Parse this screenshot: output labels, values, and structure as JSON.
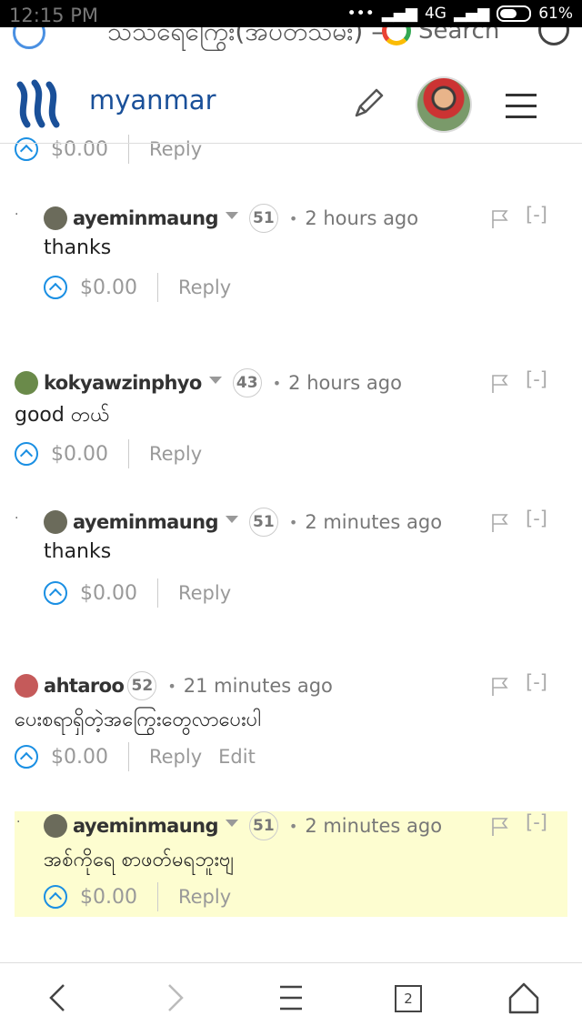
{
  "status_bar": {
    "time": "12:15 PM",
    "network": "4G",
    "battery": "61%"
  },
  "browser": {
    "address": "သသရေကြွေး(အပတသမး) –",
    "search_label": "Search"
  },
  "header": {
    "brand": "myanmar"
  },
  "top_partial": {
    "payout": "$0.00",
    "reply": "Reply"
  },
  "comments": [
    {
      "user": "ayeminmaung",
      "rep": "51",
      "time": "2 hours ago",
      "body": "thanks",
      "payout": "$0.00",
      "reply": "Reply",
      "toggle": "[-]",
      "nested": true
    },
    {
      "user": "kokyawzinphyo",
      "rep": "43",
      "time": "2 hours ago",
      "body": "good တယ်",
      "payout": "$0.00",
      "reply": "Reply",
      "toggle": "[-]",
      "nested": false
    },
    {
      "user": "ayeminmaung",
      "rep": "51",
      "time": "2 minutes ago",
      "body": "thanks",
      "payout": "$0.00",
      "reply": "Reply",
      "toggle": "[-]",
      "nested": true
    },
    {
      "user": "ahtaroo",
      "rep": "52",
      "time": "21 minutes ago",
      "body": "ပေးစရာရှိတဲ့အကြွေးတွေလာပေးပါ",
      "payout": "$0.00",
      "reply": "Reply",
      "edit": "Edit",
      "toggle": "[-]",
      "nested": false
    },
    {
      "user": "ayeminmaung",
      "rep": "51",
      "time": "2 minutes ago",
      "body": "အစ်ကိုရေ စာဖတ်မရဘူးဗျ",
      "payout": "$0.00",
      "reply": "Reply",
      "toggle": "[-]",
      "nested": true,
      "highlighted": true
    }
  ],
  "bottom_nav": {
    "tab_count": "2"
  },
  "colors": {
    "brand": "#1a5099",
    "accent": "#1a8fe3",
    "highlight": "#fdfdd0"
  }
}
